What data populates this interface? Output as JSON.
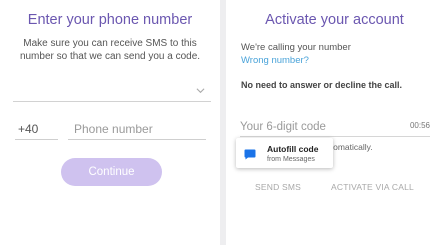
{
  "left_screen": {
    "title": "Enter your phone number",
    "description": "Make sure you can receive SMS to this number so that we can send you a code.",
    "country_select": {
      "value": "",
      "icon": "chevron-down-icon"
    },
    "country_code": "+40",
    "phone_placeholder": "Phone number",
    "continue_label": "Continue"
  },
  "right_screen": {
    "title": "Activate your account",
    "calling_text": "We're calling your number",
    "wrong_number": "Wrong number?",
    "no_need_text": "No need to answer or decline the call.",
    "code_placeholder": "Your 6-digit code",
    "timer": "00:56",
    "behind_text": "utomatically.",
    "autofill": {
      "title": "Autofill code",
      "subtitle": "from Messages",
      "icon": "message-icon"
    },
    "send_sms_label": "SEND SMS",
    "activate_call_label": "ACTIVATE VIA CALL"
  },
  "colors": {
    "accent": "#6b57b0",
    "button_disabled": "#cfc2ef",
    "link": "#4aa3d9",
    "autofill_icon": "#1a73e8"
  }
}
